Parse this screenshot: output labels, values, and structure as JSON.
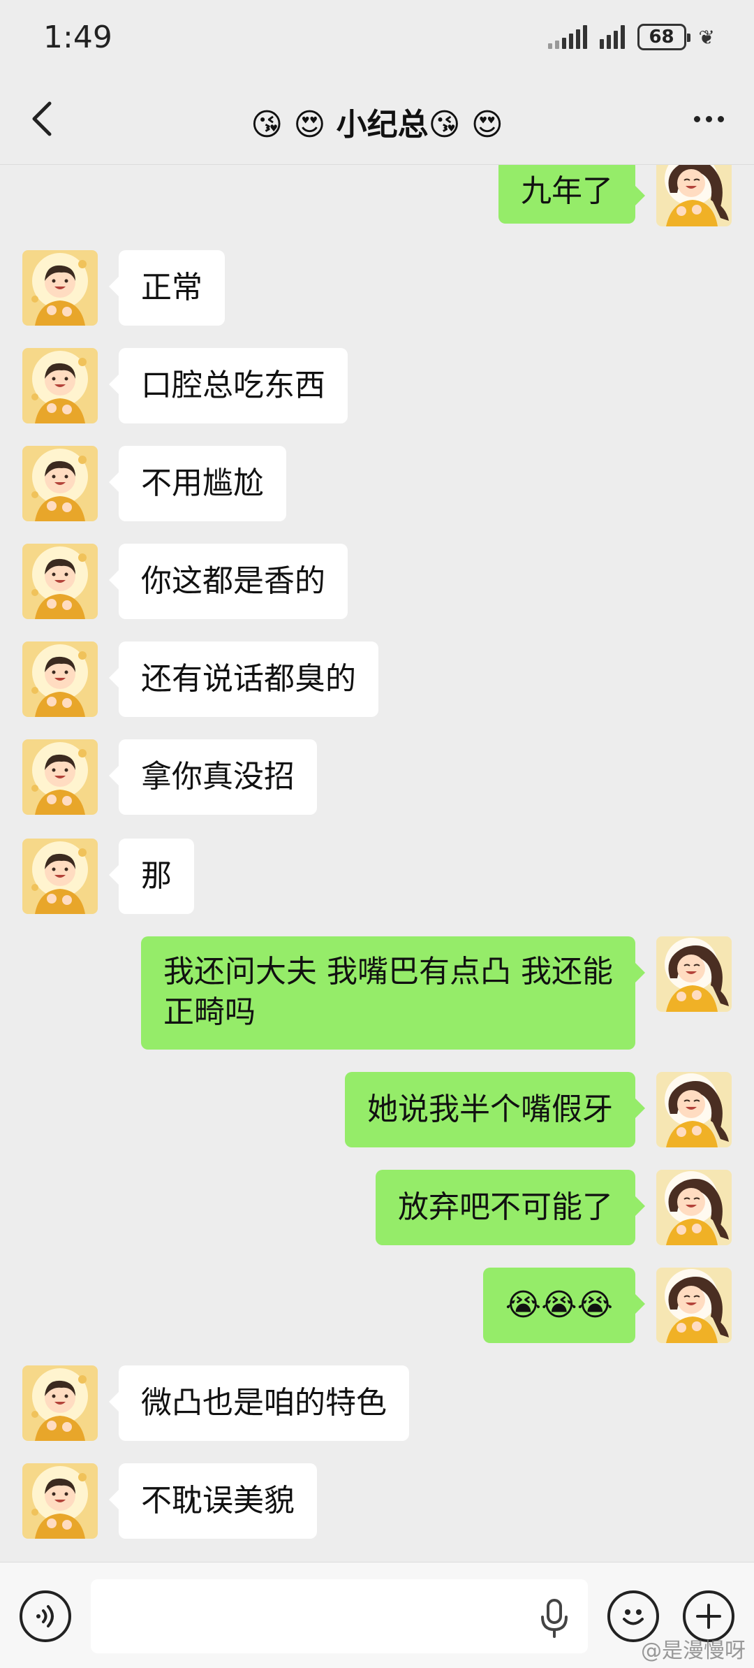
{
  "status_bar": {
    "time": "1:49",
    "battery": "68"
  },
  "header": {
    "title": "😘 😍 小纪总😘 😍"
  },
  "messages": [
    {
      "side": "right",
      "text": "九年了"
    },
    {
      "side": "left",
      "text": "正常"
    },
    {
      "side": "left",
      "text": "口腔总吃东西"
    },
    {
      "side": "left",
      "text": "不用尴尬"
    },
    {
      "side": "left",
      "text": "你这都是香的"
    },
    {
      "side": "left",
      "text": "还有说话都臭的"
    },
    {
      "side": "left",
      "text": "拿你真没招"
    },
    {
      "side": "left",
      "text": "那"
    },
    {
      "side": "right",
      "line1": "我还问大夫 我嘴巴有点凸 我还能",
      "line2": "正畸吗"
    },
    {
      "side": "right",
      "text": "她说我半个嘴假牙"
    },
    {
      "side": "right",
      "text": "放弃吧不可能了"
    },
    {
      "side": "right",
      "text": "😭😭😭"
    },
    {
      "side": "left",
      "text": "微凸也是咱的特色"
    },
    {
      "side": "left",
      "text": "不耽误美貌"
    }
  ],
  "input": {
    "value": ""
  },
  "watermark": "@是漫慢呀",
  "colors": {
    "background": "#ededed",
    "sent_bubble": "#95ec69",
    "received_bubble": "#ffffff"
  },
  "icons": [
    "back-arrow-icon",
    "more-icon",
    "voice-icon",
    "microphone-icon",
    "emoji-icon",
    "plus-icon"
  ]
}
